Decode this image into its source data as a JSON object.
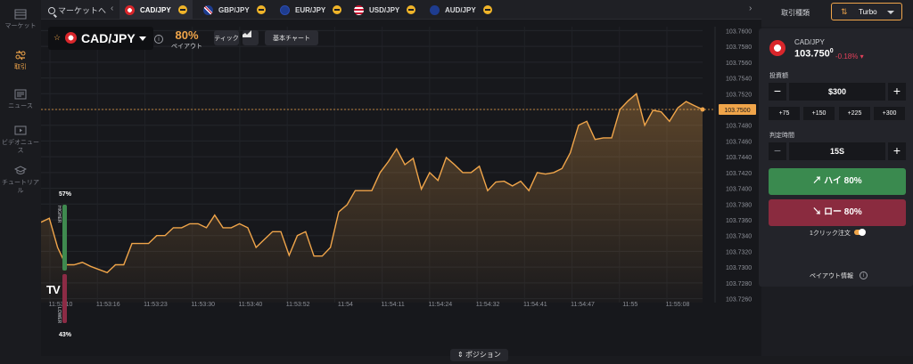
{
  "nav": {
    "items": [
      {
        "label": "マーケット",
        "icon": "market-icon"
      },
      {
        "label": "取引",
        "icon": "trade-icon"
      },
      {
        "label": "ニュース",
        "icon": "news-icon"
      },
      {
        "label": "ビデオニュース",
        "icon": "video-icon"
      },
      {
        "label": "チュートリアル",
        "icon": "tutorial-icon"
      }
    ]
  },
  "topbar": {
    "search_label": "マーケットへ",
    "tabs": [
      {
        "label": "CAD/JPY"
      },
      {
        "label": "GBP/JPY"
      },
      {
        "label": "EUR/JPY"
      },
      {
        "label": "USD/JPY"
      },
      {
        "label": "AUD/JPY"
      }
    ]
  },
  "right_header": {
    "label": "取引種類",
    "mode": "Turbo"
  },
  "asset": {
    "name": "CAD/JPY",
    "payout_pct": "80%",
    "payout_label": "ペイアウト",
    "tick_label": "ティック",
    "basic_chart_label": "基本チャート"
  },
  "sentiment": {
    "high_pct": "57%",
    "low_pct": "43%",
    "high_word": "HIGHER",
    "low_word": "LOWER"
  },
  "position_button": "ポジション",
  "panel": {
    "pair": "CAD/JPY",
    "price_main": "103.75",
    "price_tail": "0",
    "price_sup": "0",
    "change": "-0.18%",
    "amount_label": "投資額",
    "amount_value": "$300",
    "quick_amounts": [
      "+75",
      "+150",
      "+225",
      "+300"
    ],
    "time_label": "判定時間",
    "time_value": "15S",
    "high_button": "ハイ  80%",
    "low_button": "ロー  80%",
    "one_click_label": "1クリック注文",
    "payout_info_label": "ペイアウト情報"
  },
  "colors": {
    "accent": "#f0a54a",
    "high": "#3a8a4f",
    "low": "#8a2b3f",
    "negative": "#e2405a"
  },
  "chart_data": {
    "type": "area",
    "current_price": "103.7500",
    "y_ticks": [
      "103.7600",
      "103.7580",
      "103.7560",
      "103.7540",
      "103.7520",
      "103.7500",
      "103.7480",
      "103.7460",
      "103.7440",
      "103.7420",
      "103.7400",
      "103.7380",
      "103.7360",
      "103.7340",
      "103.7320",
      "103.7300",
      "103.7280",
      "103.7260"
    ],
    "x_ticks": [
      "11:53:10",
      "11:53:16",
      "11:53:23",
      "11:53:30",
      "11:53:40",
      "11:53:52",
      "11:54",
      "11:54:11",
      "11:54:24",
      "11:54:32",
      "11:54:41",
      "11:54:47",
      "11:55",
      "11:55:08"
    ],
    "ylim": [
      103.7255,
      103.7605
    ],
    "y": [
      103.7357,
      103.7362,
      103.7325,
      103.7303,
      103.7303,
      103.7306,
      103.7301,
      103.7297,
      103.7293,
      103.7303,
      103.7303,
      103.733,
      103.733,
      103.733,
      103.734,
      103.734,
      103.735,
      103.735,
      103.7355,
      103.7355,
      103.735,
      103.7366,
      103.735,
      103.735,
      103.7355,
      103.735,
      103.7325,
      103.7335,
      103.7345,
      103.7345,
      103.7315,
      103.734,
      103.7345,
      103.7314,
      103.7314,
      103.7325,
      103.737,
      103.7379,
      103.7397,
      103.7397,
      103.7397,
      103.742,
      103.7434,
      103.745,
      103.743,
      103.7438,
      103.7399,
      103.742,
      103.741,
      103.7439,
      103.743,
      103.742,
      103.742,
      103.7428,
      103.7397,
      103.7408,
      103.7409,
      103.7403,
      103.7409,
      103.7397,
      103.742,
      103.7418,
      103.742,
      103.7425,
      103.7445,
      103.748,
      103.7485,
      103.7462,
      103.7464,
      103.7464,
      103.75,
      103.7511,
      103.752,
      103.748,
      103.7499,
      103.7497,
      103.7485,
      103.7502,
      103.751,
      103.7505,
      103.75
    ]
  }
}
